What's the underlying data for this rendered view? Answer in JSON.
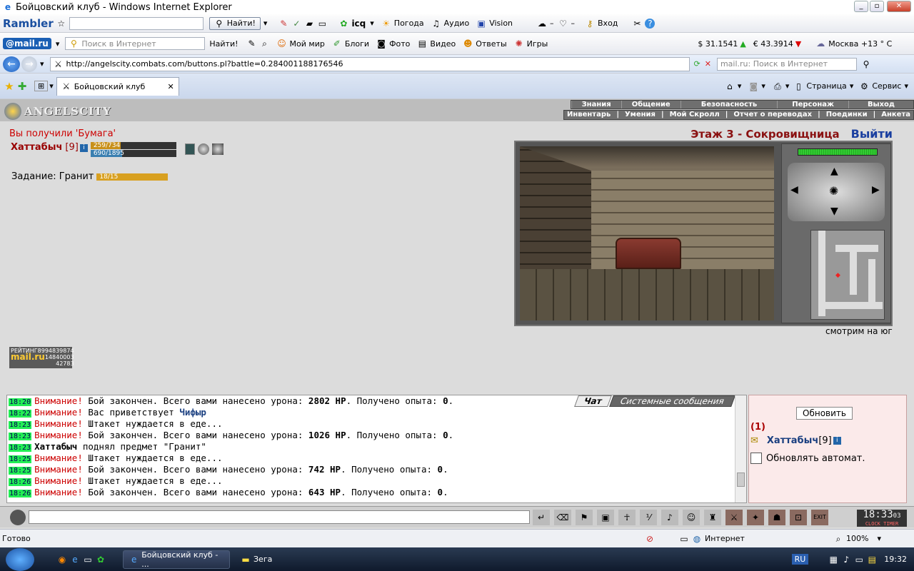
{
  "window": {
    "title": "Бойцовский клуб - Windows Internet Explorer"
  },
  "toolbar1": {
    "brand": "Rambler",
    "find_btn": "Найти!",
    "icq": "icq",
    "weather": "Погода",
    "audio": "Аудио",
    "vision": "Vision",
    "login": "Вход"
  },
  "toolbar2": {
    "brand": "@mail.ru",
    "search_placeholder": "Поиск в Интернет",
    "find_btn": "Найти!",
    "items": [
      "Мой мир",
      "Блоги",
      "Фото",
      "Видео",
      "Ответы",
      "Игры"
    ],
    "usd": "$ 31.1541",
    "eur": "€ 43.3914",
    "city": "Москва +13 ° C"
  },
  "address": {
    "url": "http://angelscity.combats.com/buttons.pl?battle=0.284001188176546",
    "search_placeholder": "mail.ru: Поиск в Интернет"
  },
  "tabs": {
    "active": "Бойцовский клуб",
    "page_menu": "Страница",
    "service_menu": "Сервис"
  },
  "game": {
    "logo": "ANGELSCITY",
    "menu_top": [
      "Знания",
      "Общение",
      "Безопасность",
      "Персонаж",
      "Выход"
    ],
    "menu_bottom": [
      "Инвентарь",
      "|",
      "Умения",
      "|",
      "Мой Скролл",
      "|",
      "Отчет о переводах",
      "|",
      "Поединки",
      "|",
      "Анкета"
    ],
    "notice": "Вы получили 'Бумага'",
    "player_name": "Хаттабыч",
    "player_level": "[9]",
    "hp_text": "259/734",
    "hp_fraction": 0.353,
    "mana_text": "690/1895",
    "mana_fraction": 0.364,
    "quest_label": "Задание: Гранит",
    "quest_text": "18/15",
    "quest_fraction": 1.0,
    "location": "Этаж 3 - Сокровищница",
    "exit_link": "Выйти",
    "facing": "смотрим на юг",
    "counter": {
      "label": "РЕЙТИНГ",
      "line1": "8994839874",
      "brand": "mail.ru",
      "line2": "14840003",
      "line3": "42783"
    }
  },
  "chat": {
    "tabs": [
      "Чат",
      "Системные сообщения"
    ],
    "lines": [
      {
        "time": "18:20",
        "pre": "Внимание!",
        "text": " Бой закончен. Всего вами нанесено урона: ",
        "bold": "2802 HP",
        "post": ". Получено опыта: ",
        "bold2": "0",
        "end": "."
      },
      {
        "time": "18:22",
        "pre": "Внимание!",
        "text": " Вас приветствует ",
        "bold": "Чифыр",
        "post": "",
        "bold2": "",
        "end": ""
      },
      {
        "time": "18:23",
        "pre": "Внимание!",
        "text": " Штакет нуждается в еде...",
        "bold": "",
        "post": "",
        "bold2": "",
        "end": ""
      },
      {
        "time": "18:23",
        "pre": "Внимание!",
        "text": " Бой закончен. Всего вами нанесено урона: ",
        "bold": "1026 HP",
        "post": ". Получено опыта: ",
        "bold2": "0",
        "end": "."
      },
      {
        "time": "18:23",
        "pre": "",
        "text": " поднял предмет \"Гранит\"",
        "bold": "",
        "post": "",
        "bold2": "",
        "end": "",
        "actor": "Хаттабыч"
      },
      {
        "time": "18:25",
        "pre": "Внимание!",
        "text": " Штакет нуждается в еде...",
        "bold": "",
        "post": "",
        "bold2": "",
        "end": ""
      },
      {
        "time": "18:25",
        "pre": "Внимание!",
        "text": " Бой закончен. Всего вами нанесено урона: ",
        "bold": "742 HP",
        "post": ". Получено опыта: ",
        "bold2": "0",
        "end": "."
      },
      {
        "time": "18:26",
        "pre": "Внимание!",
        "text": " Штакет нуждается в еде...",
        "bold": "",
        "post": "",
        "bold2": "",
        "end": ""
      },
      {
        "time": "18:26",
        "pre": "Внимание!",
        "text": " Бой закончен. Всего вами нанесено урона: ",
        "bold": "643 HP",
        "post": ". Получено опыта: ",
        "bold2": "0",
        "end": "."
      }
    ]
  },
  "side": {
    "refresh_btn": "Обновить",
    "count": "(1)",
    "user": "Хаттабыч",
    "user_level": "[9]",
    "auto_label": "Обновлять автомат."
  },
  "clock": {
    "time": "18:33",
    "sec": "03",
    "label": "CLOCK TIMER"
  },
  "statusbar": {
    "text": "Готово",
    "zone": "Интернет",
    "zoom": "100%"
  },
  "taskbar": {
    "items": [
      "Бойцовский клуб - ...",
      "Зега"
    ],
    "lang": "RU",
    "time": "19:32"
  }
}
